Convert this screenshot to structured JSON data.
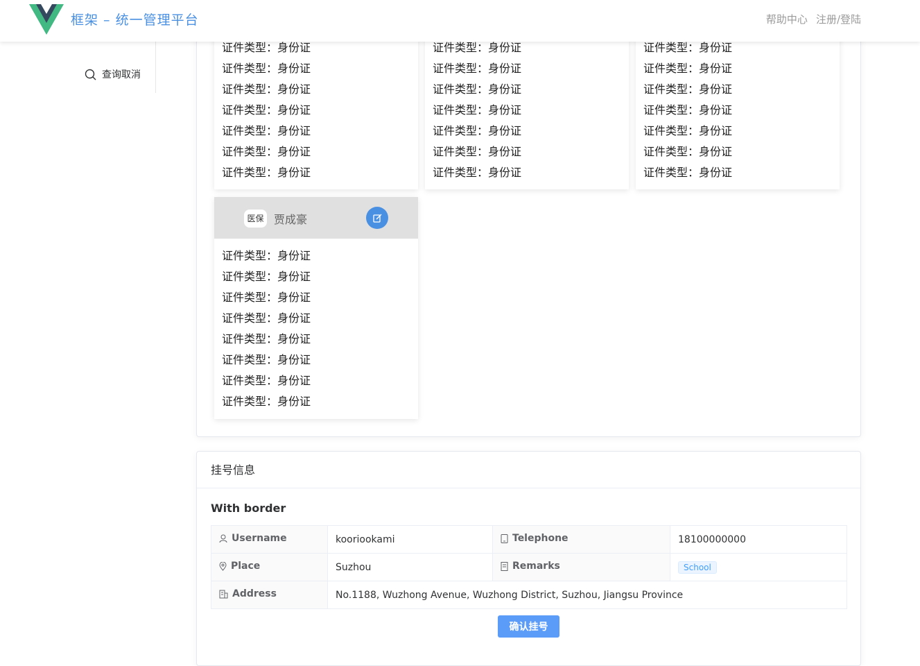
{
  "header": {
    "title": "框架 – 统一管理平台",
    "links": [
      "帮助中心",
      "注册/登陆"
    ],
    "brand_colors": {
      "logo_outer": "#42b883",
      "logo_inner": "#35495e",
      "title": "#4a90e2"
    }
  },
  "sidebar": {
    "items": [
      {
        "label": "查询取消",
        "icon": "search-icon"
      }
    ]
  },
  "cards": {
    "line_text": "证件类型：身份证",
    "row1_line_count": 7,
    "last_card": {
      "tag": "医保",
      "name": "贾成豪",
      "line_count": 8,
      "icon": "edit-icon"
    }
  },
  "registration": {
    "title": "挂号信息",
    "subtitle": "With border",
    "fields": {
      "username_label": "Username",
      "username_value": "kooriookami",
      "telephone_label": "Telephone",
      "telephone_value": "18100000000",
      "place_label": "Place",
      "place_value": "Suzhou",
      "remarks_label": "Remarks",
      "remarks_value": "School",
      "address_label": "Address",
      "address_value": "No.1188, Wuzhong Avenue, Wuzhong District, Suzhou, Jiangsu Province"
    },
    "confirm_label": "确认挂号"
  }
}
